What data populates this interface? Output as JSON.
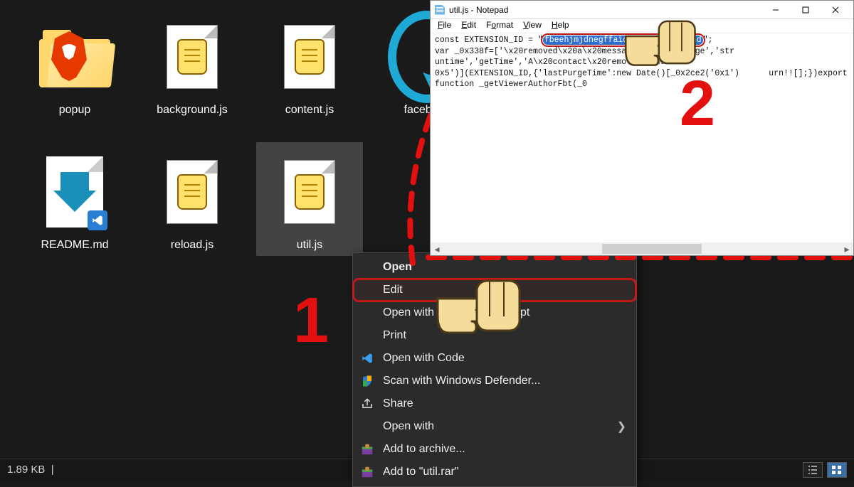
{
  "files": {
    "popup": "popup",
    "background": "background.js",
    "content": "content.js",
    "facebook": "facebook",
    "readme": "README.md",
    "reload": "reload.js",
    "util": "util.js"
  },
  "context_menu": {
    "open": "Open",
    "edit": "Edit",
    "open_cmd": "Open with Command Prompt",
    "print": "Print",
    "open_code": "Open with Code",
    "defender": "Scan with Windows Defender...",
    "share": "Share",
    "open_with": "Open with",
    "add_archive": "Add to archive...",
    "add_rar": "Add to \"util.rar\""
  },
  "status": {
    "size": "1.89 KB"
  },
  "notepad": {
    "title": "util.js - Notepad",
    "menu": {
      "file": "File",
      "edit": "Edit",
      "format": "Format",
      "view": "View",
      "help": "Help"
    },
    "line1_pre": "const EXTENSION_ID = ",
    "selection": "fbeehjmjdnegffaidcbkcpmlaehiapnd",
    "line1_post": ";",
    "line2": "var _0x338f=['\\x20removed\\x20a\\x20message','sendMessage','str        untime','getTime','A\\x20contact\\x20removed\\x20a",
    "line3": "0x5')](EXTENSION_ID,{'lastPurgeTime':new Date()[_0x2ce2('0x1')      urn!![];})export function _getViewerAuthorFbt(_0"
  },
  "annotations": {
    "num1": "1",
    "num2": "2"
  }
}
